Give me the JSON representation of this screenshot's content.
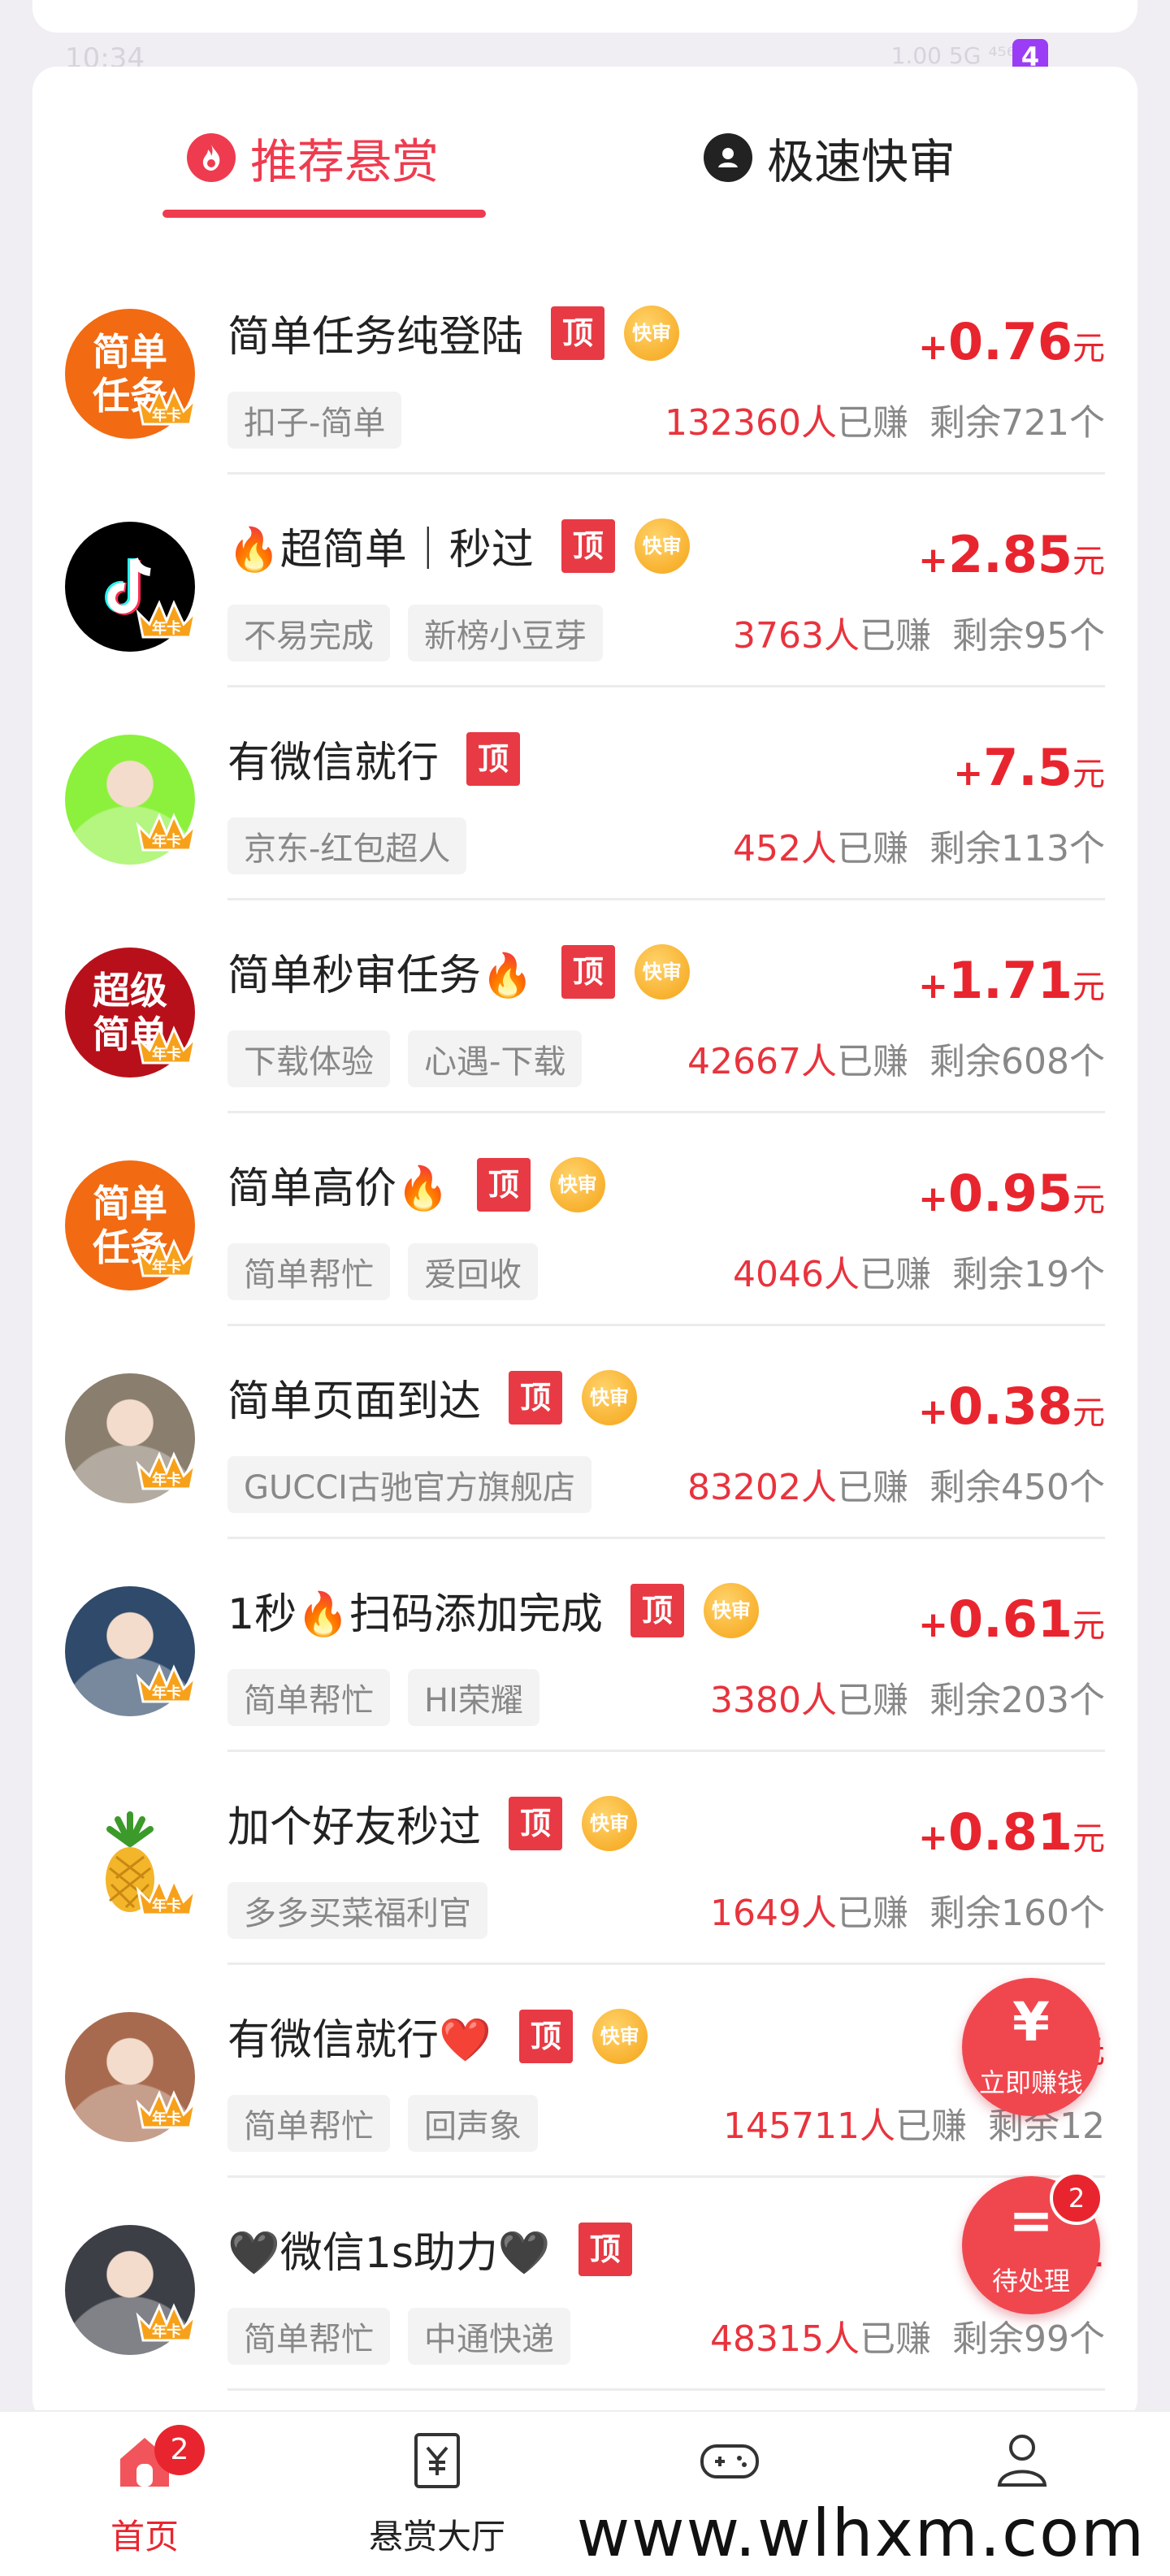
{
  "status_bar": {
    "time": "10:34",
    "network": "1.00 5G ⁴⁵⁶",
    "badge": "4"
  },
  "tabs": [
    {
      "label": "推荐悬赏",
      "icon": "flame-icon",
      "active": true
    },
    {
      "label": "极速快审",
      "icon": "user-circle-icon",
      "active": false
    }
  ],
  "tags": {
    "top": "顶",
    "fast": "快审"
  },
  "tasks": [
    {
      "title": "简单任务纯登陆",
      "fast": true,
      "reward_plus": "+",
      "reward": "0.76",
      "unit": "元",
      "chips": [
        "扣子-简单"
      ],
      "earned_count": "132360人",
      "earned_text": "已赚",
      "remaining": "剩余721个",
      "avatar_text": "简单任务",
      "avatar_color": "#f26a12"
    },
    {
      "title": "🔥超简单｜秒过",
      "fast": true,
      "reward_plus": "+",
      "reward": "2.85",
      "unit": "元",
      "chips": [
        "不易完成",
        "新榜小豆芽"
      ],
      "earned_count": "3763人",
      "earned_text": "已赚",
      "remaining": "剩余95个",
      "avatar_text": "",
      "avatar_color": "#000000"
    },
    {
      "title": "有微信就行",
      "fast": false,
      "reward_plus": "+",
      "reward": "7.5",
      "unit": "元",
      "chips": [
        "京东-红包超人"
      ],
      "earned_count": "452人",
      "earned_text": "已赚",
      "remaining": "剩余113个",
      "avatar_text": "",
      "avatar_color": "#8cf13c"
    },
    {
      "title": "简单秒审任务🔥",
      "fast": true,
      "reward_plus": "+",
      "reward": "1.71",
      "unit": "元",
      "chips": [
        "下载体验",
        "心遇-下载"
      ],
      "earned_count": "42667人",
      "earned_text": "已赚",
      "remaining": "剩余608个",
      "avatar_text": "超级简单",
      "avatar_color": "#b8101a"
    },
    {
      "title": "简单高价🔥",
      "fast": true,
      "reward_plus": "+",
      "reward": "0.95",
      "unit": "元",
      "chips": [
        "简单帮忙",
        "爱回收"
      ],
      "earned_count": "4046人",
      "earned_text": "已赚",
      "remaining": "剩余19个",
      "avatar_text": "简单任务",
      "avatar_color": "#f26a12"
    },
    {
      "title": "简单页面到达",
      "fast": true,
      "reward_plus": "+",
      "reward": "0.38",
      "unit": "元",
      "chips": [
        "GUCCI古驰官方旗舰店"
      ],
      "earned_count": "83202人",
      "earned_text": "已赚",
      "remaining": "剩余450个",
      "avatar_text": "",
      "avatar_color": "#8a7e6e"
    },
    {
      "title": "1秒🔥扫码添加完成",
      "fast": true,
      "reward_plus": "+",
      "reward": "0.61",
      "unit": "元",
      "chips": [
        "简单帮忙",
        "HI荣耀"
      ],
      "earned_count": "3380人",
      "earned_text": "已赚",
      "remaining": "剩余203个",
      "avatar_text": "",
      "avatar_color": "#2f4a6a"
    },
    {
      "title": "加个好友秒过",
      "fast": true,
      "reward_plus": "+",
      "reward": "0.81",
      "unit": "元",
      "chips": [
        "多多买菜福利官"
      ],
      "earned_count": "1649人",
      "earned_text": "已赚",
      "remaining": "剩余160个",
      "avatar_text": "",
      "avatar_color": "#ffffff"
    },
    {
      "title": "有微信就行❤️",
      "fast": true,
      "reward_plus": "+",
      "reward": "0.",
      "unit": "元",
      "chips": [
        "简单帮忙",
        "回声象"
      ],
      "earned_count": "145711人",
      "earned_text": "已赚",
      "remaining": "剩余12",
      "avatar_text": "",
      "avatar_color": "#a86a4e"
    },
    {
      "title": "🖤微信1s助力🖤",
      "fast": false,
      "reward_plus": "+",
      "reward": "",
      "unit": "",
      "chips": [
        "简单帮忙",
        "中通快递"
      ],
      "earned_count": "48315人",
      "earned_text": "已赚",
      "remaining": "剩余99个",
      "avatar_text": "",
      "avatar_color": "#3d3f47"
    }
  ],
  "fab": {
    "earn": {
      "symbol": "¥",
      "label": "立即赚钱"
    },
    "pending": {
      "symbol": "=",
      "label": "待处理",
      "badge": "2"
    }
  },
  "bottom_nav": [
    {
      "label": "首页",
      "icon": "home-icon",
      "badge": "2",
      "active": true
    },
    {
      "label": "悬赏大厅",
      "icon": "reward-hall-icon",
      "active": false
    },
    {
      "label": "",
      "icon": "gamepad-icon",
      "active": false
    },
    {
      "label": "",
      "icon": "profile-icon",
      "active": false
    }
  ],
  "watermark": "www.wlhxm.com",
  "crown_label": "年卡"
}
